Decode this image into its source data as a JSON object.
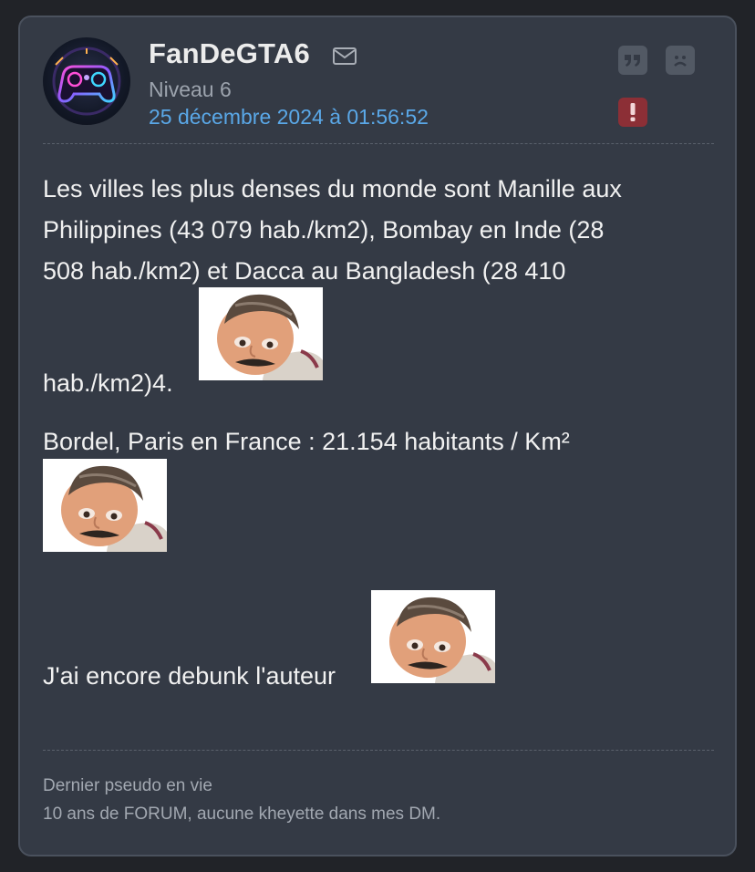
{
  "post": {
    "author": "FanDeGTA6",
    "level": "Niveau 6",
    "date": "25 décembre 2024 à 01:56:52",
    "body": {
      "line1": "Les villes les plus denses du monde sont Manille aux",
      "line2": "Philippines (43 079 hab./km2), Bombay en Inde (28",
      "line3": "508 hab./km2) et Dacca au Bangladesh (28 410",
      "line4": "hab./km2)4.",
      "line5": "Bordel, Paris en France : 21.154 habitants / Km²",
      "line6": "J'ai encore debunk l'auteur"
    },
    "signature": {
      "line1": "Dernier pseudo en vie",
      "line2": "10 ans de FORUM, aucune kheyette dans mes DM."
    }
  },
  "icons": {
    "mail": "envelope-icon",
    "quote": "quote-icon",
    "sad": "sad-face-icon",
    "alert": "exclamation-icon",
    "avatar": "gamepad-avatar",
    "sticker": "risitas-sticker"
  },
  "colors": {
    "card_bg": "#343a45",
    "page_bg": "#212328",
    "date_link": "#5aa8e8",
    "alert_bg": "#8c2f36"
  }
}
